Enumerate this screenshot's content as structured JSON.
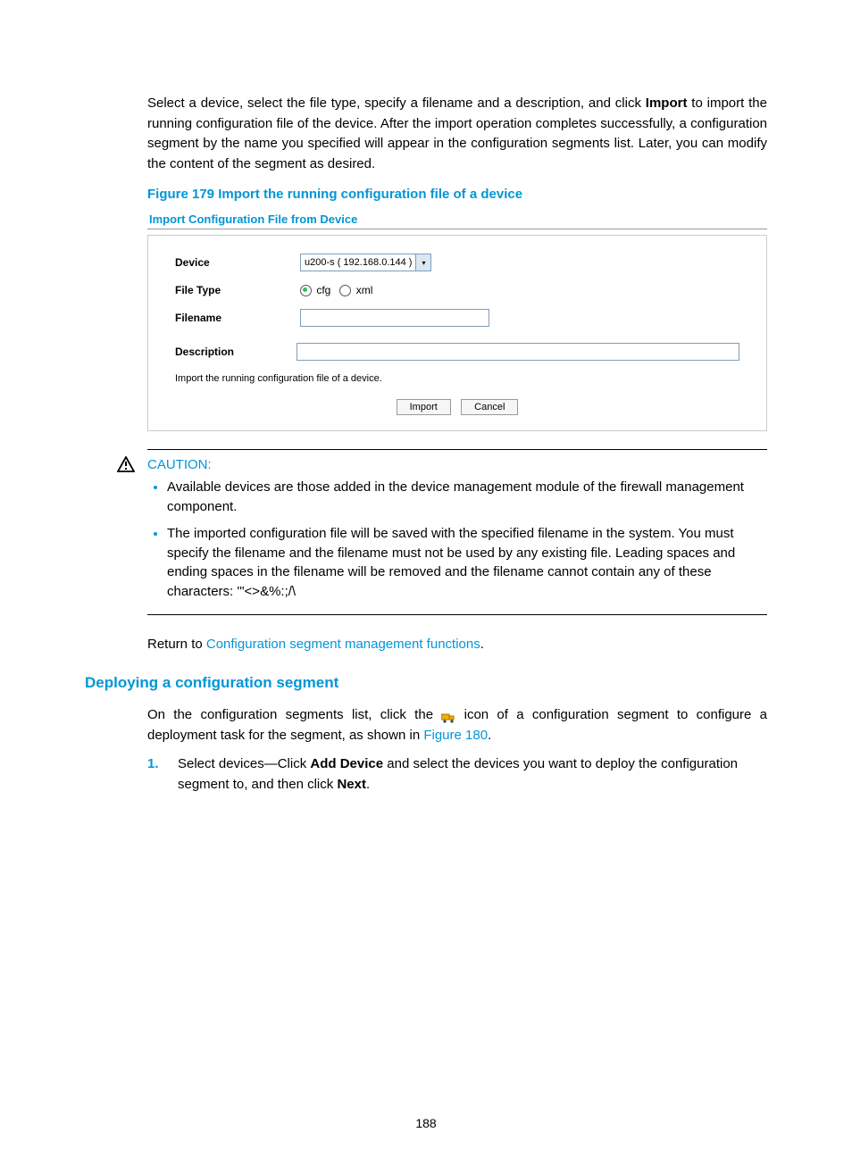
{
  "intro": {
    "part1": "Select a device, select the file type, specify a filename and a description, and click ",
    "bold": "Import",
    "part2": " to import the running configuration file of the device. After the import operation completes successfully, a configuration segment by the name you specified will appear in the configuration segments list. Later, you can modify the content of the segment as desired."
  },
  "figure_caption": "Figure 179 Import the running configuration file of a device",
  "panel": {
    "title": "Import Configuration File from Device",
    "labels": {
      "device": "Device",
      "file_type": "File Type",
      "filename": "Filename",
      "description": "Description"
    },
    "device_value": "u200-s ( 192.168.0.144 )",
    "file_type_options": {
      "cfg": "cfg",
      "xml": "xml"
    },
    "file_type_selected": "cfg",
    "filename_value": "",
    "description_value": "",
    "helper": "Import the running configuration file of a device.",
    "buttons": {
      "import": "Import",
      "cancel": "Cancel"
    }
  },
  "caution": {
    "title": "CAUTION:",
    "items": [
      "Available devices are those added in the device management module of the firewall management component.",
      "The imported configuration file will be saved with the specified filename in the system. You must specify the filename and the filename must not be used by any existing file. Leading spaces and ending spaces in the filename will be removed and the filename cannot contain any of these characters: '\"<>&%:;/\\"
    ]
  },
  "return": {
    "prefix": "Return to ",
    "link": "Configuration segment management functions",
    "suffix": "."
  },
  "section_heading": "Deploying a configuration segment",
  "deploy": {
    "p1a": "On the configuration segments list, click the ",
    "p1b": " icon of a configuration segment to configure a deployment task for the segment, as shown in ",
    "fig_link": "Figure 180",
    "p1c": "."
  },
  "step1": {
    "num": "1.",
    "a": "Select devices—Click ",
    "b1": "Add Device",
    "c": " and select the devices you want to deploy the configuration segment to, and then click ",
    "b2": "Next",
    "d": "."
  },
  "page_number": "188"
}
